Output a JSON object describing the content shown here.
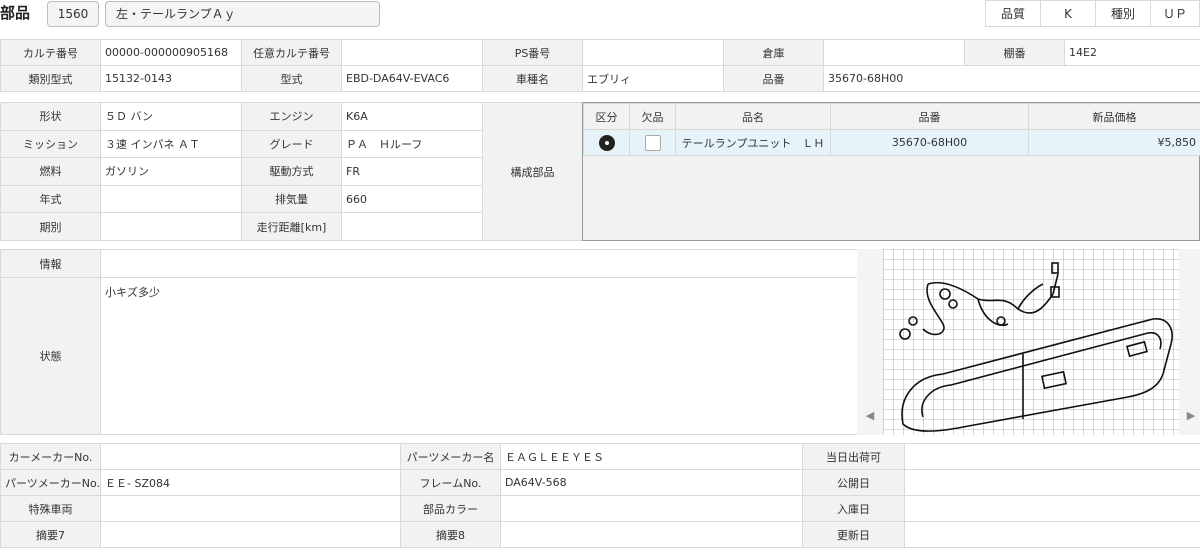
{
  "header": {
    "title": "部品",
    "part_code": "1560",
    "part_name": "左・テールランプＡｙ",
    "quality_label": "品質",
    "quality_value": "K",
    "type_label": "種別",
    "type_value": "ＵＰ"
  },
  "info_top": {
    "karte_no_label": "カルテ番号",
    "karte_no": "00000-000000905168",
    "any_karte_label": "任意カルテ番号",
    "any_karte": "",
    "ps_no_label": "PS番号",
    "ps_no": "",
    "warehouse_label": "倉庫",
    "warehouse": "",
    "shelf_label": "棚番",
    "shelf": "14E2",
    "class_model_label": "類別型式",
    "class_model": "15132-0143",
    "model_label": "型式",
    "model": "EBD-DA64V-EVAC6",
    "car_name_label": "車種名",
    "car_name": "エブリィ",
    "part_no_label": "品番",
    "part_no": "35670-68H00"
  },
  "vehicle": {
    "shape_label": "形状",
    "shape": "５Ｄ バン",
    "engine_label": "エンジン",
    "engine": "K6A",
    "mission_label": "ミッション",
    "mission": "３速 インパネ ＡＴ",
    "grade_label": "グレード",
    "grade": "ＰＡ　Ｈルーフ",
    "fuel_label": "燃料",
    "fuel": "ガソリン",
    "drive_label": "駆動方式",
    "drive": "FR",
    "year_label": "年式",
    "year": "",
    "displacement_label": "排気量",
    "displacement": "660",
    "period_label": "期別",
    "period": "",
    "mileage_label": "走行距離[km]",
    "mileage": "",
    "components_label": "構成部品"
  },
  "components": {
    "headers": [
      "区分",
      "欠品",
      "品名",
      "品番",
      "新品価格"
    ],
    "rows": [
      {
        "name": "テールランプユニット　ＬＨ",
        "part_no": "35670-68H00",
        "price": "¥5,850"
      }
    ]
  },
  "notes": {
    "info_label": "情報",
    "info": "",
    "condition_label": "状態",
    "condition": "小キズ多少"
  },
  "bottom": {
    "car_maker_no_label": "カーメーカーNo.",
    "car_maker_no": "",
    "parts_maker_name_label": "パーツメーカー名",
    "parts_maker_name": "ＥＡＧＬＥＥＹＥＳ",
    "same_day_label": "当日出荷可",
    "parts_maker_no_label": "パーツメーカーNo.",
    "parts_maker_no": "ＥＥ- SZ084",
    "frame_no_label": "フレームNo.",
    "frame_no": "DA64V-568",
    "publish_date_label": "公開日",
    "special_vehicle_label": "特殊車両",
    "special_vehicle": "",
    "part_color_label": "部品カラー",
    "part_color": "",
    "arrival_date_label": "入庫日",
    "summary7_label": "摘要7",
    "summary7": "",
    "summary8_label": "摘要8",
    "summary8": "",
    "update_date_label": "更新日"
  },
  "image_viewer": {
    "prev_icon": "chevron-left-icon",
    "next_icon": "chevron-right-icon"
  }
}
